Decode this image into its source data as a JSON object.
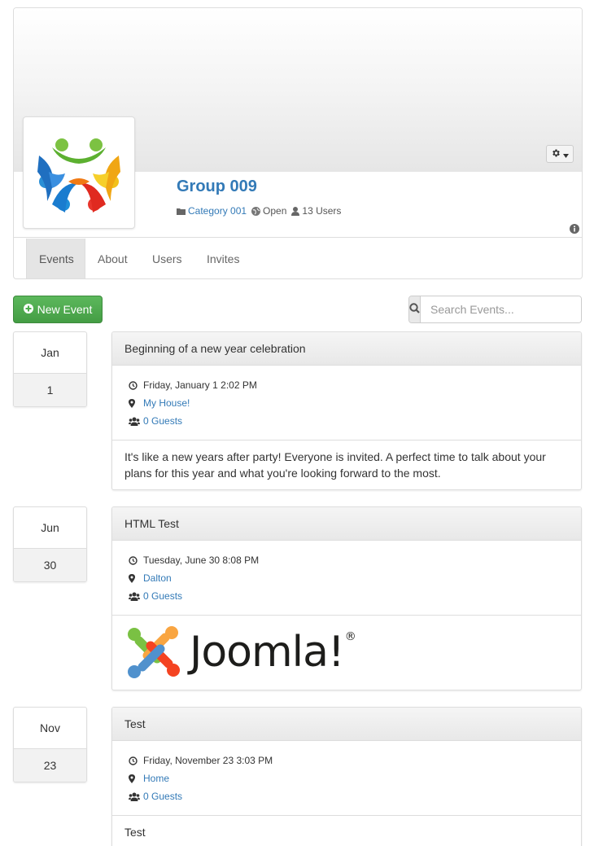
{
  "group": {
    "title": "Group 009",
    "category": "Category 001",
    "privacy": "Open",
    "users": "13 Users"
  },
  "tabs": [
    {
      "label": "Events",
      "active": true
    },
    {
      "label": "About",
      "active": false
    },
    {
      "label": "Users",
      "active": false
    },
    {
      "label": "Invites",
      "active": false
    }
  ],
  "toolbar": {
    "new_event_label": "New Event",
    "search_placeholder": "Search Events..."
  },
  "events": [
    {
      "month": "Jan",
      "day": "1",
      "title": "Beginning of a new year celebration",
      "datetime": "Friday, January 1 2:02 PM",
      "location": "My House!",
      "guests": "0 Guests",
      "description": "It's like a new years after party! Everyone is invited. A perfect time to talk about your plans for this year and what you're looking forward to the most."
    },
    {
      "month": "Jun",
      "day": "30",
      "title": "HTML Test",
      "datetime": "Tuesday, June 30 8:08 PM",
      "location": "Dalton",
      "guests": "0 Guests",
      "image_text": "Joomla!",
      "image_mark": "®"
    },
    {
      "month": "Nov",
      "day": "23",
      "title": "Test",
      "datetime": "Friday, November 23 3:03 PM",
      "location": "Home",
      "guests": "0 Guests",
      "description": "Test"
    }
  ],
  "colors": {
    "link": "#337ab7",
    "success": "#5cb85c",
    "tab_active_bg": "#e5e5e5"
  }
}
